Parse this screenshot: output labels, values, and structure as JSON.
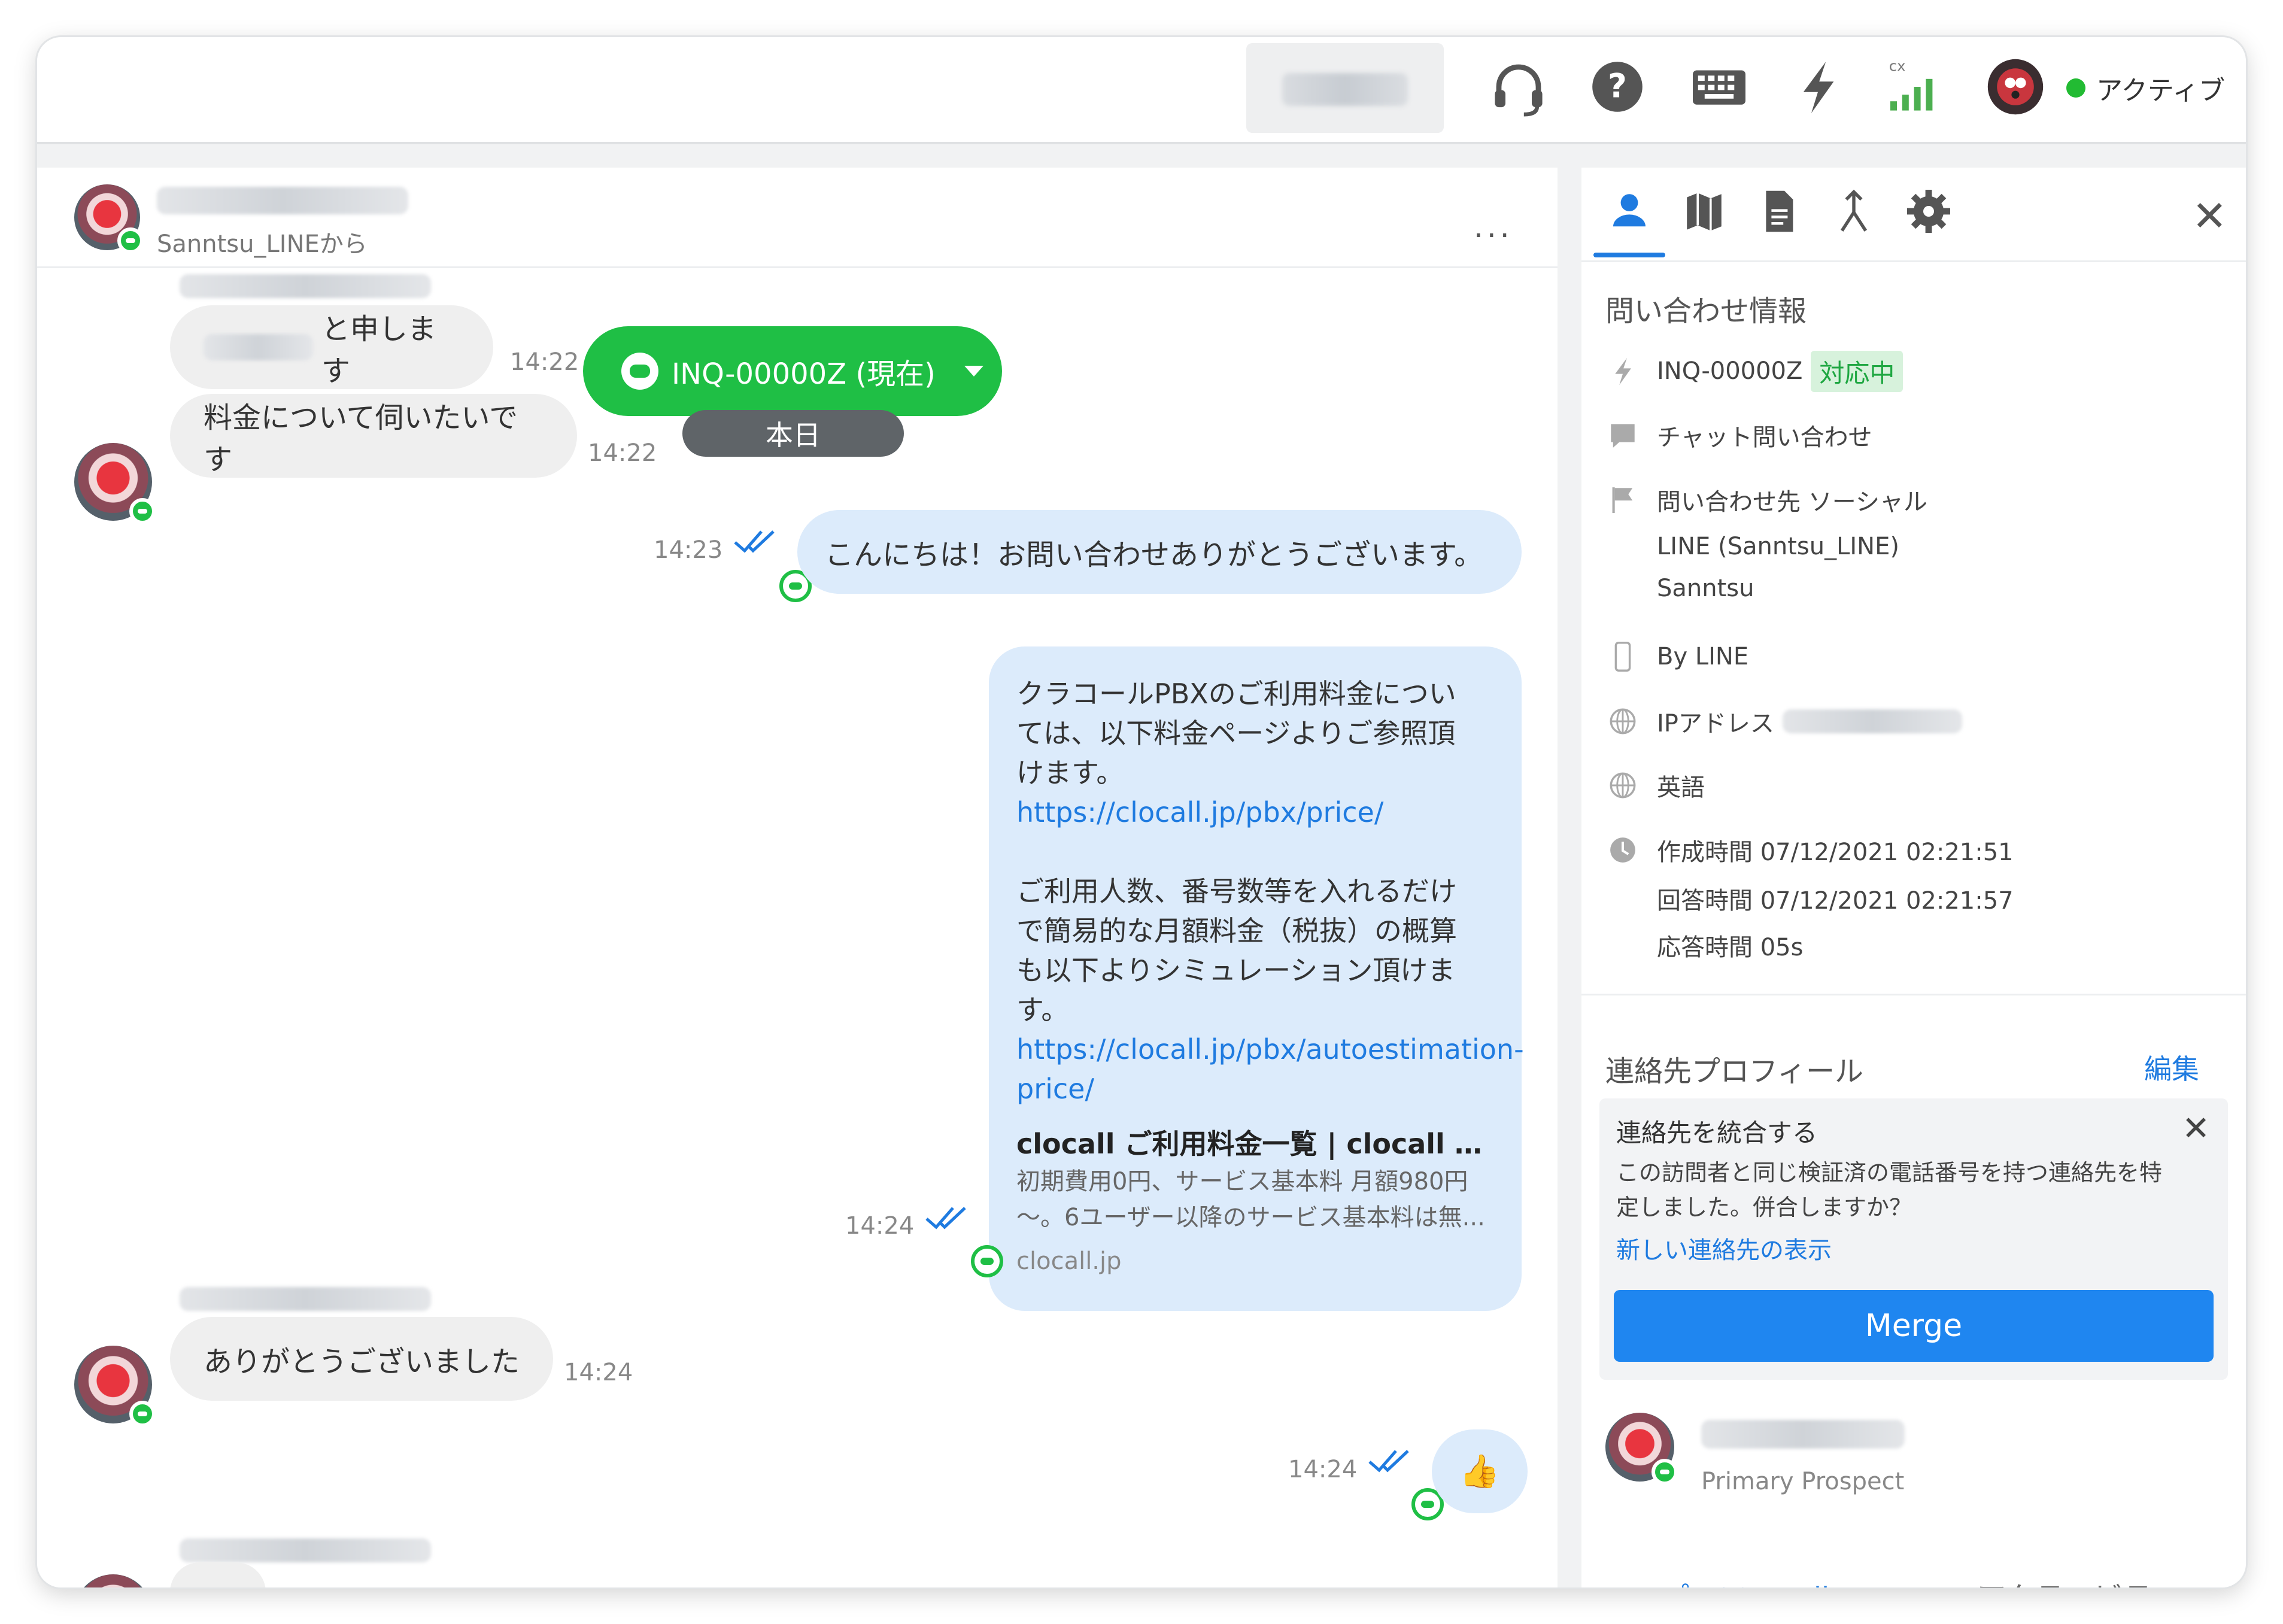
{
  "topbar": {
    "status_label": "アクティブ",
    "signal_label": "cx",
    "icons": [
      "headset-icon",
      "help-icon",
      "keyboard-icon",
      "bolt-icon",
      "signal-icon",
      "avatar-icon"
    ]
  },
  "chat": {
    "header": {
      "source": "Sanntsu_LINEから",
      "more_label": "..."
    },
    "inquiry_pill": {
      "label": "INQ-00000Z (現在)"
    },
    "date_pill": "本日",
    "messages": [
      {
        "dir": "in",
        "text": "と申します",
        "time": "14:22"
      },
      {
        "dir": "in",
        "text": "料金について伺いたいです",
        "time": "14:22"
      },
      {
        "dir": "out",
        "text": "こんにちは！お問い合わせありがとうございます。",
        "time": "14:23"
      },
      {
        "dir": "out",
        "time": "14:24",
        "p1_l1": "クラコールPBXのご利用料金につい",
        "p1_l2": "ては、以下料金ページよりご参照頂",
        "p1_l3": "けます。",
        "link1": "https://clocall.jp/pbx/price/",
        "p2_l1": "ご利用人数、番号数等を入れるだけ",
        "p2_l2": "で簡易的な月額料金（税抜）の概算",
        "p2_l3": "も以下よりシミュレーション頂けま",
        "p2_l4": "す。",
        "link2_l1": "https://clocall.jp/pbx/autoestimation-",
        "link2_l2": "price/",
        "preview_title": "clocall ご利用料金一覧 | clocall 【 ...",
        "preview_desc_l1": "初期費用0円、サービス基本料 月額980円",
        "preview_desc_l2": "～。6ユーザー以降のサービス基本料は無...",
        "preview_domain": "clocall.jp"
      },
      {
        "dir": "in",
        "text": "ありがとうございました",
        "time": "14:24"
      },
      {
        "dir": "out",
        "text": "👍",
        "time": "14:24"
      }
    ]
  },
  "panel": {
    "tabs": [
      "contact-tab",
      "map-tab",
      "document-tab",
      "merge-tab",
      "settings-tab"
    ],
    "inquiry_info_title": "問い合わせ情報",
    "inquiry_id": "INQ-00000Z",
    "inquiry_status": "対応中",
    "chat_type": "チャット問い合わせ",
    "channel_label": "問い合わせ先 ソーシャル",
    "channel_line2": "LINE (Sanntsu_LINE)",
    "channel_line3": "Sanntsu",
    "by_line": "By LINE",
    "ip_label": "IPアドレス",
    "language": "英語",
    "created": "作成時間 07/12/2021 02:21:51",
    "answered": "回答時間 07/12/2021 02:21:57",
    "response": "応答時間 05s",
    "contact_profile_title": "連絡先プロフィール",
    "edit_label": "編集",
    "merge_card": {
      "title": "連絡先を統合する",
      "text_l1": "この訪問者と同じ検証済の電話番号を持つ連絡先を特",
      "text_l2": "定しました。併合しますか？",
      "link": "新しい連絡先の表示",
      "button": "Merge"
    },
    "prospect_label": "Primary Prospect",
    "bottom_tabs": [
      "プロフィール",
      "アクティビティ"
    ]
  },
  "colors": {
    "green": "#1fbf45",
    "blue": "#1f7be0",
    "bubble_out": "#dcebfb",
    "bubble_in": "#efefef"
  }
}
